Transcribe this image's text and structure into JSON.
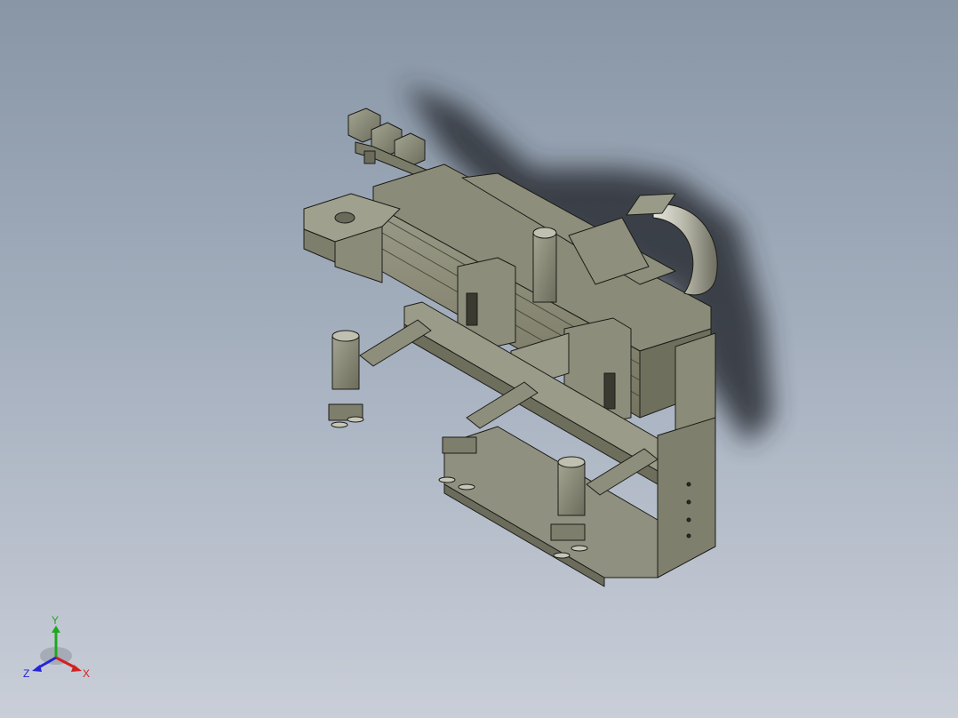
{
  "viewport": {
    "background_top": "#8896a6",
    "background_bottom": "#c9ced8"
  },
  "model": {
    "body_color": "#8a8a78",
    "shadow_color": "#2a2f36",
    "edge_color": "#1c1c18"
  },
  "triad": {
    "x_label": "X",
    "y_label": "Y",
    "z_label": "Z",
    "x_color": "#d42020",
    "y_color": "#1fa81f",
    "z_color": "#2424d8"
  }
}
